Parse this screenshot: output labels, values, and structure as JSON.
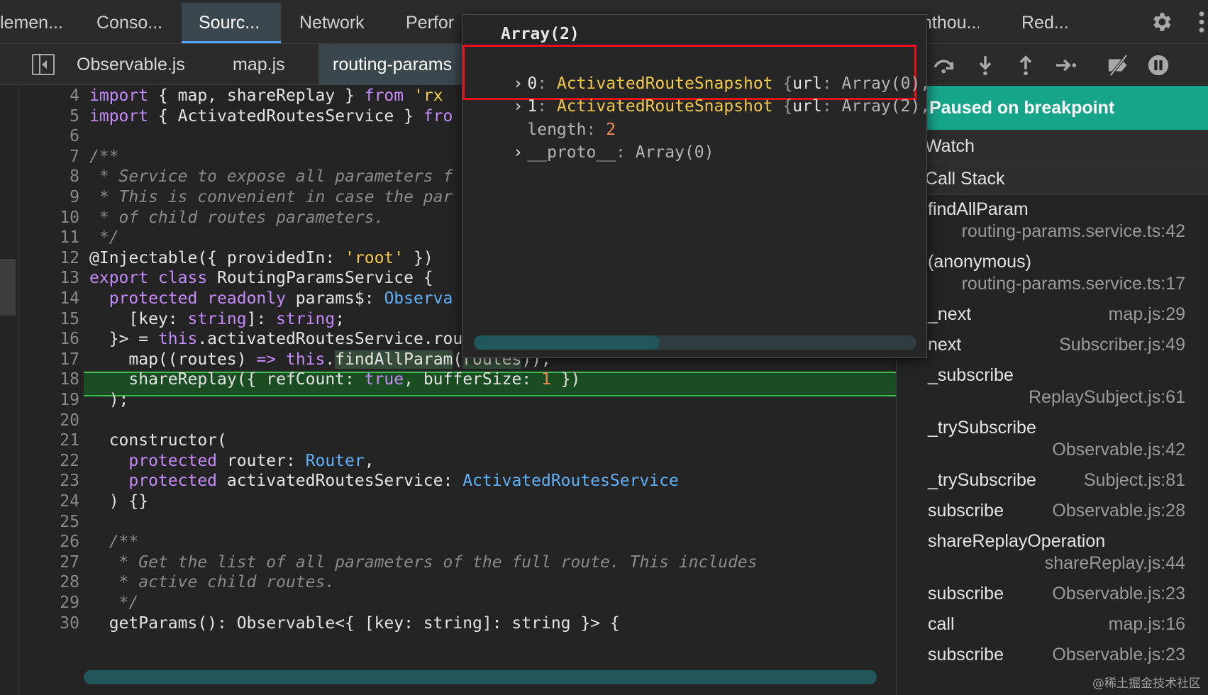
{
  "top_tabs": [
    "lemen...",
    "Conso...",
    "Sourc...",
    "Network",
    "Perfor",
    "nthou...",
    "Red..."
  ],
  "file_tabs": [
    "Observable.js",
    "map.js",
    "routing-params"
  ],
  "code_lines": [
    {
      "n": "4",
      "html": "<span class='kw'>import</span> { map, shareReplay } <span class='kw'>from</span> <span class='str'>'rx</span>"
    },
    {
      "n": "5",
      "html": "<span class='kw'>import</span> { ActivatedRoutesService } <span class='kw'>fro</span>"
    },
    {
      "n": "6",
      "html": ""
    },
    {
      "n": "7",
      "html": "<span class='cm'>/**</span>"
    },
    {
      "n": "8",
      "html": "<span class='cm'> * Service to expose all parameters f</span>"
    },
    {
      "n": "9",
      "html": "<span class='cm'> * This is convenient in case the par</span>"
    },
    {
      "n": "10",
      "html": "<span class='cm'> * of child routes parameters.</span>"
    },
    {
      "n": "11",
      "html": "<span class='cm'> */</span>"
    },
    {
      "n": "12",
      "html": "@Injectable({ providedIn: <span class='str'>'root'</span> })"
    },
    {
      "n": "13",
      "html": "<span class='kw'>export class</span> RoutingParamsService {"
    },
    {
      "n": "14",
      "html": "  <span class='kw'>protected readonly</span> params$: <span class='ty'>Observa</span>"
    },
    {
      "n": "15",
      "html": "    [key: <span class='kw'>string</span>]: <span class='kw'>string</span>;"
    },
    {
      "n": "16",
      "html": "  }&gt; = <span class='kw'>this</span>.activatedRoutesService.route$.pipe("
    },
    {
      "n": "17",
      "html": "    map((routes) <span class='kw'>=&gt;</span> <span class='kw'>this</span>.<span class='hl'>findAllParam</span>(<span class='hl'>routes</span>)),"
    },
    {
      "n": "18",
      "html": "    shareReplay({ refCount: <span class='kw'>true</span>, bufferSize: <span class='num'>1</span> })"
    },
    {
      "n": "19",
      "html": "  );"
    },
    {
      "n": "20",
      "html": ""
    },
    {
      "n": "21",
      "html": "  constructor("
    },
    {
      "n": "22",
      "html": "    <span class='kw'>protected</span> router: <span class='ty'>Router</span>,"
    },
    {
      "n": "23",
      "html": "    <span class='kw'>protected</span> activatedRoutesService: <span class='ty'>ActivatedRoutesService</span>"
    },
    {
      "n": "24",
      "html": "  ) {}"
    },
    {
      "n": "25",
      "html": ""
    },
    {
      "n": "26",
      "html": "  <span class='cm'>/**</span>"
    },
    {
      "n": "27",
      "html": "<span class='cm'>   * Get the list of all parameters of the full route. This includes</span>"
    },
    {
      "n": "28",
      "html": "<span class='cm'>   * active child routes.</span>"
    },
    {
      "n": "29",
      "html": "<span class='cm'>   */</span>"
    },
    {
      "n": "30",
      "html": "  getParams(): Observable&lt;{ [key: string]: string }&gt; {"
    }
  ],
  "popover": {
    "title": "Array(2)",
    "items": [
      {
        "index": "0",
        "class_name": "ActivatedRouteSnapshot",
        "preview_open": " {",
        "preview_key": "url",
        "preview_colon": ": ",
        "preview_val": "Array(0)",
        "preview_end": ","
      },
      {
        "index": "1",
        "class_name": "ActivatedRouteSnapshot",
        "preview_open": " {",
        "preview_key": "url",
        "preview_colon": ": ",
        "preview_val": "Array(2)",
        "preview_end": ","
      }
    ],
    "length_key": "length",
    "length_val": "2",
    "proto_key": "__proto__",
    "proto_val": "Array(0)"
  },
  "debugger": {
    "paused_text": "Paused on breakpoint",
    "watch_label": "Watch",
    "call_stack_label": "Call Stack",
    "frames": [
      {
        "name": "findAllParam",
        "loc": "routing-params.service.ts:42",
        "two_line": true
      },
      {
        "name": "(anonymous)",
        "loc": "routing-params.service.ts:17",
        "two_line": true
      },
      {
        "name": "_next",
        "loc": "map.js:29",
        "two_line": false
      },
      {
        "name": "next",
        "loc": "Subscriber.js:49",
        "two_line": false
      },
      {
        "name": "_subscribe",
        "loc": "ReplaySubject.js:61",
        "two_line": true
      },
      {
        "name": "_trySubscribe",
        "loc": "Observable.js:42",
        "two_line": true
      },
      {
        "name": "_trySubscribe",
        "loc": "Subject.js:81",
        "two_line": false
      },
      {
        "name": "subscribe",
        "loc": "Observable.js:28",
        "two_line": false
      },
      {
        "name": "shareReplayOperation",
        "loc": "shareReplay.js:44",
        "two_line": true
      },
      {
        "name": "subscribe",
        "loc": "Observable.js:23",
        "two_line": false
      },
      {
        "name": "call",
        "loc": "map.js:16",
        "two_line": false
      },
      {
        "name": "subscribe",
        "loc": "Observable.js:23",
        "two_line": false
      }
    ]
  },
  "watermark": "@稀土掘金技术社区",
  "colors": {
    "accent_tab": "#3a474d",
    "paused_bar": "#17a58a",
    "exec_line": "#1b4d22",
    "highlight_box": "#e8101a"
  }
}
